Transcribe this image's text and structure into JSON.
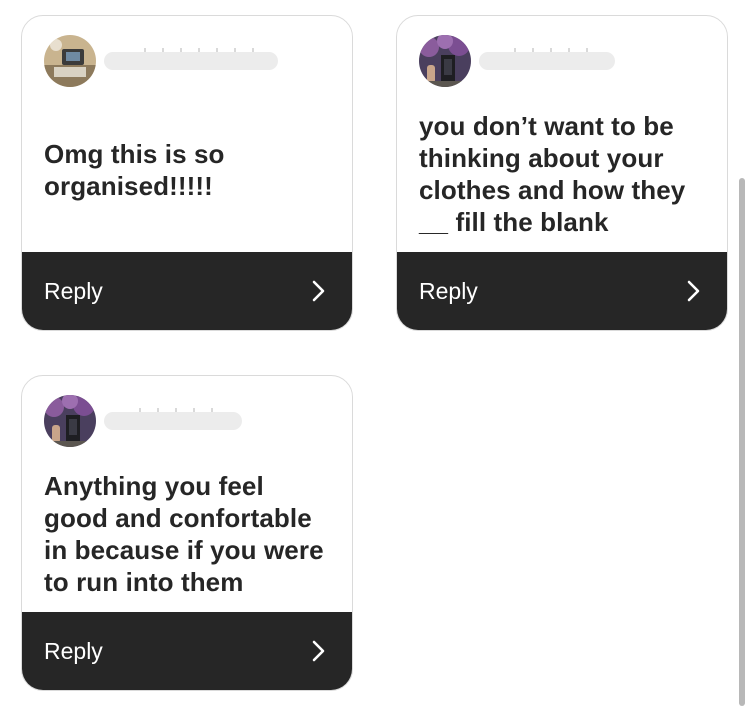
{
  "cards": [
    {
      "text_lines": [
        "Omg this is so",
        "organised!!!!!"
      ],
      "reply_label": "Reply"
    },
    {
      "text_lines": [
        "you don’t want to be",
        "thinking about your",
        "clothes and how they",
        "__ fill the blank"
      ],
      "reply_label": "Reply"
    },
    {
      "text_lines": [
        "Anything you feel",
        "good and confortable",
        "in because if you were",
        "to run into them"
      ],
      "reply_label": "Reply"
    }
  ],
  "icons": {
    "reply_arrow": "chevron-right-icon"
  },
  "colors": {
    "reply_bar": "#262626",
    "card_border": "#dadada",
    "text": "#262626"
  }
}
